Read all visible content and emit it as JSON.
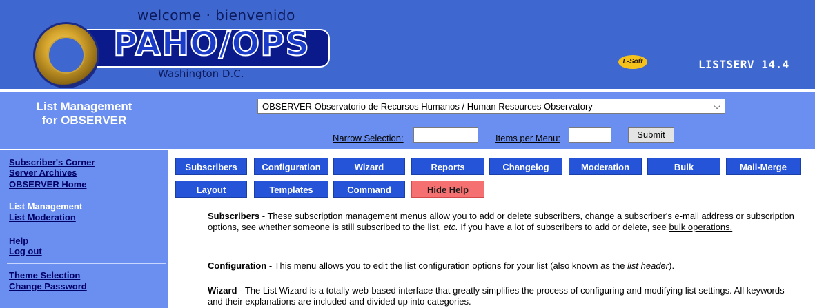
{
  "banner": {
    "welcome": "welcome · bienvenido",
    "logo_text": "PAHO/OPS",
    "location": "Washington D.C.",
    "lsoft_logo": "L-Soft",
    "product": "LISTSERV 14.4",
    "brand_color": "#3e67cf"
  },
  "management": {
    "title_line1": "List Management",
    "title_line2": "for OBSERVER",
    "selected_list": "OBSERVER Observatorio de Recursos Humanos / Human Resources Observatory",
    "narrow_label": "Narrow Selection:",
    "narrow_value": "",
    "items_label": "Items per Menu:",
    "items_value": "",
    "submit_label": "Submit"
  },
  "sidebar": {
    "subscribers_corner": "Subscriber's Corner",
    "server_archives": "Server Archives",
    "observer_home": "OBSERVER Home",
    "list_management": "List Management",
    "list_moderation": "List Moderation",
    "help": "Help",
    "logout": "Log out",
    "theme_selection": "Theme Selection",
    "change_password": "Change Password"
  },
  "nav": {
    "subscribers": "Subscribers",
    "configuration": "Configuration",
    "wizard": "Wizard",
    "reports": "Reports",
    "changelog": "Changelog",
    "moderation": "Moderation",
    "bulk": "Bulk",
    "mail_merge": "Mail-Merge",
    "layout": "Layout",
    "templates": "Templates",
    "command": "Command",
    "hide_help": "Hide Help"
  },
  "help": {
    "subscribers_title": "Subscribers",
    "subscribers_text_a": " - These subscription management menus allow you to add or delete subscribers, change a subscriber's e-mail address or subscription options, see whether someone is still subscribed to the list, ",
    "subscribers_etc": "etc.",
    "subscribers_text_b": " If you have a lot of subscribers to add or delete, see ",
    "subscribers_link": "bulk operations.",
    "configuration_title": "Configuration",
    "configuration_text": " - This menu allows you to edit the list configuration options for your list (also known as the ",
    "configuration_italic": "list header",
    "configuration_end": ").",
    "wizard_title": "Wizard",
    "wizard_text": " - The List Wizard is a totally web-based interface that greatly simplifies the process of configuring and modifying list settings. All keywords and their explanations are included and divided up into categories."
  }
}
